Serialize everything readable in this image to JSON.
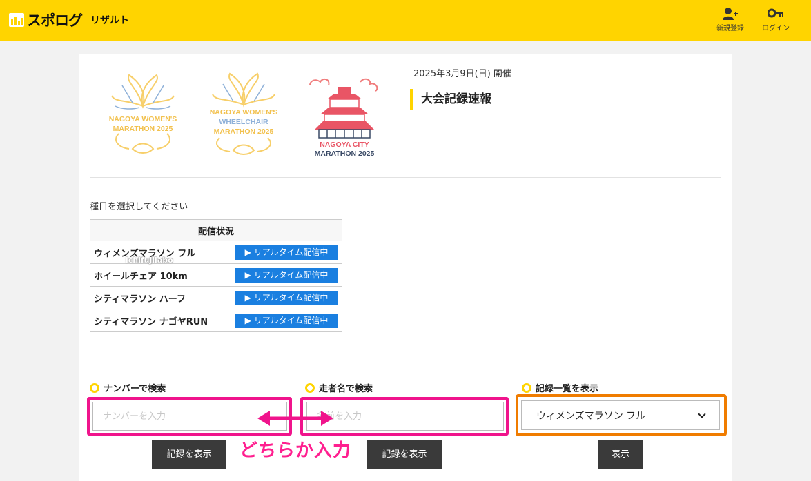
{
  "header": {
    "logo_text": "スポログ",
    "logo_sub": "リザルト",
    "register_label": "新規登録",
    "login_label": "ログイン",
    "brand_color": "#ffd400"
  },
  "race_logos": [
    {
      "line1": "NAGOYA WOMEN'S",
      "line2": "MARATHON 2025"
    },
    {
      "line1": "NAGOYA WOMEN'S",
      "line2": "WHEELCHAIR",
      "line3": "MARATHON 2025"
    },
    {
      "line1": "NAGOYA CITY",
      "line2": "MARATHON 2025"
    }
  ],
  "event": {
    "date": "2025年3月9日(日) 開催",
    "title": "大会記録速報"
  },
  "select_prompt": "種目を選択してください",
  "status_table": {
    "header": "配信状況",
    "rows": [
      {
        "name": "ウィメンズマラソン フル",
        "status": "▶ リアルタイム配信中"
      },
      {
        "name": "ホイールチェア 10km",
        "status": "▶ リアルタイム配信中"
      },
      {
        "name": "シティマラソン ハーフ",
        "status": "▶ リアルタイム配信中"
      },
      {
        "name": "シティマラソン ナゴヤRUN",
        "status": "▶ リアルタイム配信中"
      }
    ]
  },
  "watermark": "ichifujilabo",
  "search_number": {
    "label": "ナンバーで検索",
    "placeholder": "ナンバーを入力",
    "value": "",
    "button": "記録を表示"
  },
  "search_name": {
    "label": "走者名で検索",
    "placeholder": "名前を入力",
    "value": "",
    "button": "記録を表示"
  },
  "record_list": {
    "label": "記録一覧を表示",
    "selected": "ウィメンズマラソン フル",
    "button": "表示"
  },
  "annotation": {
    "text": "どちらか入力",
    "pink": "#f0148c",
    "orange": "#f07c00"
  }
}
